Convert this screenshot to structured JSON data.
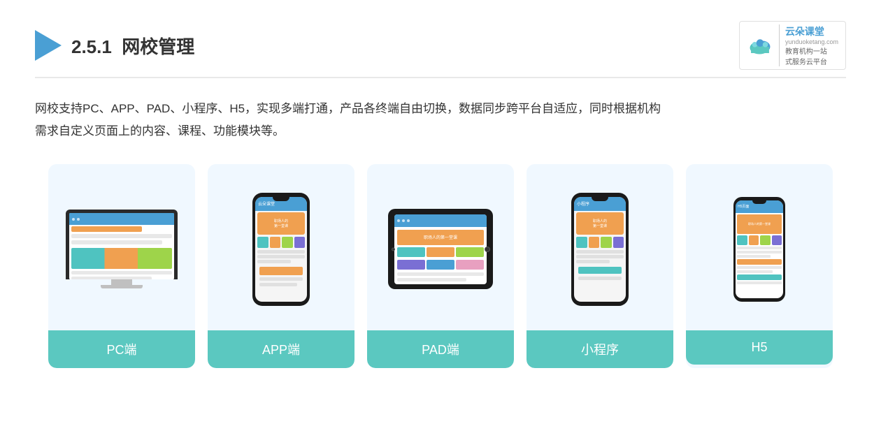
{
  "header": {
    "section_number": "2.5.1",
    "title_plain": "",
    "title_bold": "网校管理"
  },
  "brand": {
    "name": "云朵课堂",
    "url": "yunduoketang.com",
    "tagline_line1": "教育机构一站",
    "tagline_line2": "式服务云平台"
  },
  "description": {
    "text_line1": "网校支持PC、APP、PAD、小程序、H5，实现多端打通，产品各终端自由切换，数据同步跨平台自适应，同时根据机构",
    "text_line2": "需求自定义页面上的内容、课程、功能模块等。"
  },
  "cards": [
    {
      "id": "pc",
      "label": "PC端"
    },
    {
      "id": "app",
      "label": "APP端"
    },
    {
      "id": "pad",
      "label": "PAD端"
    },
    {
      "id": "miniprogram",
      "label": "小程序"
    },
    {
      "id": "h5",
      "label": "H5"
    }
  ],
  "colors": {
    "card_bg": "#eef6fc",
    "card_label_bg": "#5bc8c0",
    "accent_blue": "#4a9fd4",
    "accent_orange": "#f0a050",
    "accent_green": "#9ed44a",
    "accent_teal": "#4fc3c0",
    "accent_purple": "#7a6fd4"
  }
}
